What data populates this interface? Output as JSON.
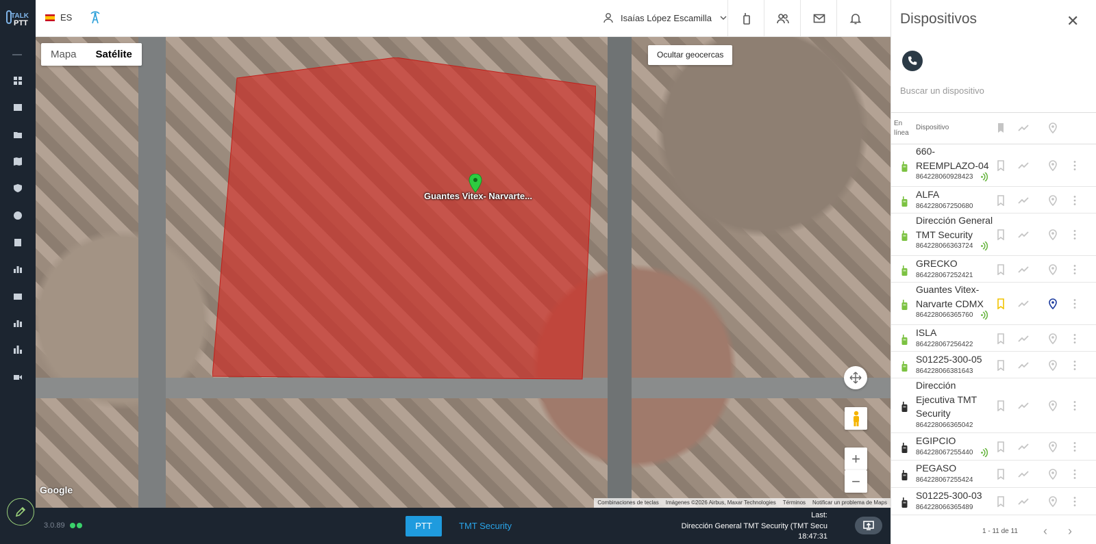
{
  "app": {
    "logo_top": "TALK",
    "logo_bottom": "PTT",
    "version": "3.0.89"
  },
  "header": {
    "language": "ES",
    "user_name": "Isaías López Escamilla"
  },
  "map": {
    "type_options": [
      "Mapa",
      "Satélite"
    ],
    "active_type": "Satélite",
    "hide_geofences_label": "Ocultar geocercas",
    "marker_label": "Guantes Vitex- Narvarte...",
    "zoom_in": "+",
    "zoom_out": "−",
    "google_label": "Google",
    "attribution": {
      "shortcuts": "Combinaciones de teclas",
      "imagery": "Imágenes ©2026 Airbus, Maxar Technologies",
      "terms": "Términos",
      "report": "Notificar un problema de Maps"
    },
    "geofence_color": "#d12b24"
  },
  "footer": {
    "ptt_label": "PTT",
    "org_label": "TMT Security",
    "last_label": "Last:",
    "last_device": "Dirección General TMT Security (TMT Secu",
    "last_time": "18:47:31"
  },
  "panel": {
    "title": "Dispositivos",
    "close": "✕",
    "search_placeholder": "Buscar un dispositivo",
    "col_online": "En línea",
    "col_device": "Dispositivo",
    "devices": [
      {
        "name": "660-REEMPLAZO-04",
        "imei": "864228060928423",
        "online": true,
        "wave": true,
        "bookmarked": false,
        "located": false
      },
      {
        "name": "ALFA",
        "imei": "864228067250680",
        "online": true,
        "wave": false,
        "bookmarked": false,
        "located": false
      },
      {
        "name": "Dirección General TMT Security",
        "imei": "864228066363724",
        "online": true,
        "wave": true,
        "bookmarked": false,
        "located": false
      },
      {
        "name": "GRECKO",
        "imei": "864228067252421",
        "online": true,
        "wave": false,
        "bookmarked": false,
        "located": false
      },
      {
        "name": "Guantes Vitex- Narvarte CDMX",
        "imei": "864228066365760",
        "online": true,
        "wave": true,
        "bookmarked": true,
        "located": true
      },
      {
        "name": "ISLA",
        "imei": "864228067256422",
        "online": true,
        "wave": false,
        "bookmarked": false,
        "located": false
      },
      {
        "name": "S01225-300-05",
        "imei": "864228066381643",
        "online": true,
        "wave": false,
        "bookmarked": false,
        "located": false
      },
      {
        "name": "Dirección Ejecutiva TMT Security",
        "imei": "864228066365042",
        "online": false,
        "wave": false,
        "bookmarked": false,
        "located": false
      },
      {
        "name": "EGIPCIO",
        "imei": "864228067255440",
        "online": false,
        "wave": true,
        "bookmarked": false,
        "located": false
      },
      {
        "name": "PEGASO",
        "imei": "864228067255424",
        "online": false,
        "wave": false,
        "bookmarked": false,
        "located": false
      },
      {
        "name": "S01225-300-03",
        "imei": "864228066365489",
        "online": false,
        "wave": false,
        "bookmarked": false,
        "located": false
      }
    ],
    "pagination": "1 - 11 de 11",
    "colors": {
      "online": "#7cc242",
      "offline": "#2e2e2e",
      "bookmark_active": "#f2c300",
      "location_active": "#1b3a9e",
      "inactive": "#c4c4c4"
    }
  }
}
